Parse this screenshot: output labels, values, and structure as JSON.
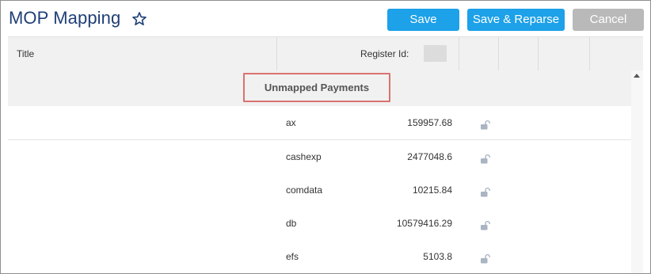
{
  "header": {
    "title": "MOP Mapping",
    "favorite_icon": "star-outline-icon",
    "buttons": {
      "save": "Save",
      "save_reparse": "Save & Reparse",
      "cancel": "Cancel"
    }
  },
  "grid": {
    "columns": {
      "title": "Title",
      "register_id_label": "Register Id:"
    },
    "group": {
      "label": "Unmapped Payments"
    },
    "rows": [
      {
        "name": "ax",
        "amount": "159957.68",
        "icon": "unlock-icon"
      },
      {
        "name": "cashexp",
        "amount": "2477048.6",
        "icon": "unlock-icon"
      },
      {
        "name": "comdata",
        "amount": "10215.84",
        "icon": "unlock-icon"
      },
      {
        "name": "db",
        "amount": "10579416.29",
        "icon": "unlock-icon"
      },
      {
        "name": "efs",
        "amount": "5103.8",
        "icon": "unlock-icon"
      }
    ]
  },
  "colors": {
    "title": "#1f3f77",
    "primary_button": "#1da1e8",
    "disabled_button": "#b9b9b9",
    "highlight_border": "#d9726f",
    "header_bg": "#f1f1f1"
  }
}
